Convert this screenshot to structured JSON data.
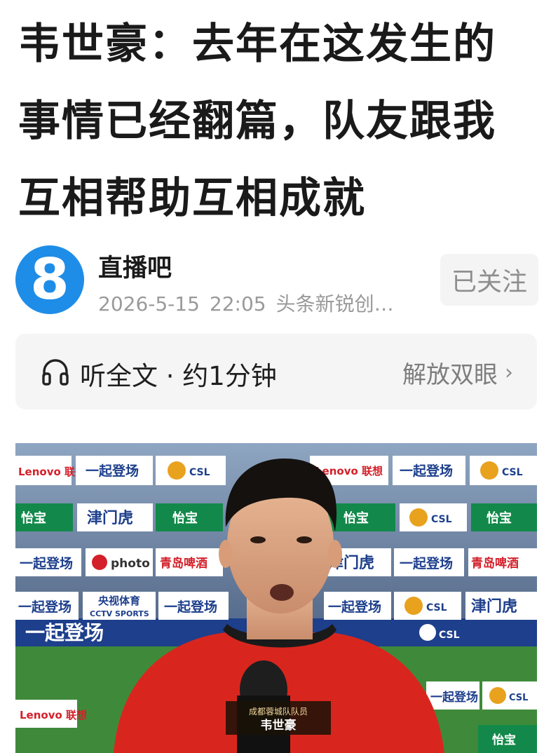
{
  "article": {
    "title": "韦世豪：去年在这发生的事情已经翻篇，队友跟我互相帮助互相成就"
  },
  "author": {
    "avatar_text": "8",
    "name": "直播吧",
    "date": "2026-5-15",
    "time": "22:05",
    "source": "头条新锐创…",
    "follow_label": "已关注"
  },
  "listen": {
    "label": "听全文 · 约1分钟",
    "mode_label": "解放双眼",
    "mode_chevron": "›"
  },
  "photo": {
    "caption_team": "成都蓉城队队员",
    "caption_name": "韦世豪",
    "board_texts": {
      "yiqi": "一起登场",
      "csl": "CSL",
      "lenovo": "Lenovo 联想",
      "jinmenhu": "津门虎",
      "yibao": "怡宝",
      "photo": "photo",
      "qingdao": "青岛啤酒",
      "cctv": "央视体育",
      "cctv_sub": "CCTV SPORTS"
    }
  },
  "colors": {
    "avatar_blue": "#1e8de8",
    "jersey_red": "#d8261e",
    "board_blue": "#1d3f8c",
    "pitch_green": "#3f8a3a"
  },
  "icons": [
    "headphones-icon",
    "chevron-right-icon"
  ]
}
